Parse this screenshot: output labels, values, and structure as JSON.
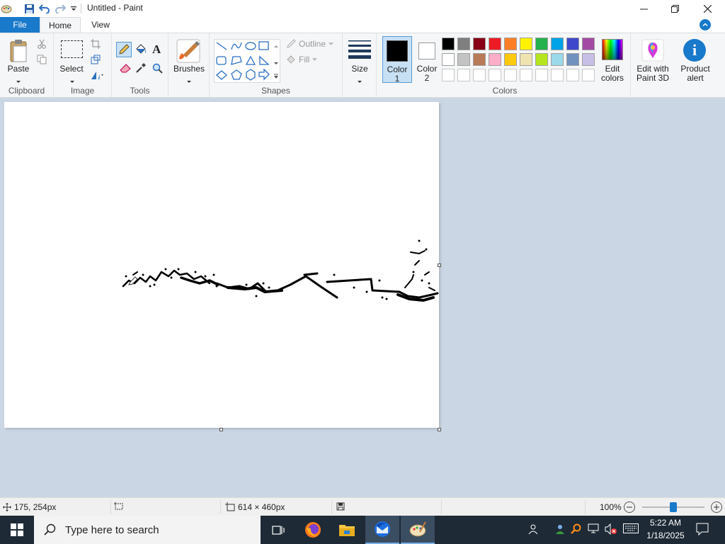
{
  "window": {
    "title": "Untitled - Paint"
  },
  "tabs": {
    "file": "File",
    "home": "Home",
    "view": "View"
  },
  "ribbon": {
    "clipboard": {
      "paste": "Paste",
      "group": "Clipboard"
    },
    "image": {
      "select": "Select",
      "group": "Image"
    },
    "tools": {
      "group": "Tools"
    },
    "brushes": {
      "label": "Brushes"
    },
    "shapes": {
      "outline": "Outline",
      "fill": "Fill",
      "group": "Shapes"
    },
    "size": {
      "label": "Size"
    },
    "color1": {
      "line1": "Color",
      "line2": "1",
      "value": "#000000"
    },
    "color2": {
      "line1": "Color",
      "line2": "2",
      "value": "#ffffff"
    },
    "colors": {
      "group": "Colors"
    },
    "edit_colors": {
      "line1": "Edit",
      "line2": "colors"
    },
    "paint3d": {
      "line1": "Edit with",
      "line2": "Paint 3D"
    },
    "product_alert": {
      "line1": "Product",
      "line2": "alert"
    }
  },
  "palette_row1": [
    "#000000",
    "#7f7f7f",
    "#880015",
    "#ed1c24",
    "#ff7f27",
    "#fff200",
    "#22b14c",
    "#00a2e8",
    "#3f48cc",
    "#a349a4"
  ],
  "palette_row2": [
    "#ffffff",
    "#c3c3c3",
    "#b97a57",
    "#ffaec9",
    "#ffc90e",
    "#efe4b0",
    "#b5e61d",
    "#99d9ea",
    "#7092be",
    "#c8bfe7"
  ],
  "status": {
    "cursor_pos": "175, 254px",
    "selection_size": "",
    "canvas_size": "614 × 460px",
    "file_size": "",
    "zoom": "100%",
    "zoom_level": 0.5
  },
  "taskbar": {
    "search_placeholder": "Type here to search",
    "time": "5:22 AM",
    "date": "1/18/2025"
  }
}
